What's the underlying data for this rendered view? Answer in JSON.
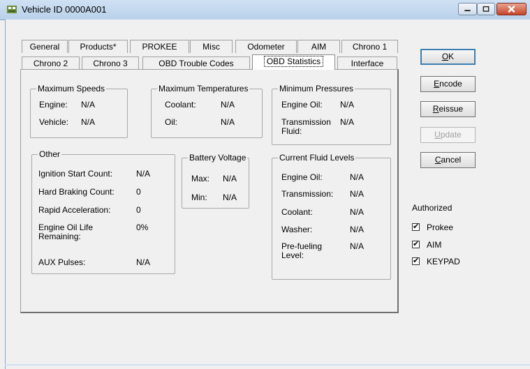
{
  "window": {
    "title": "Vehicle ID 0000A001"
  },
  "tabs": {
    "row1": [
      "General",
      "Products*",
      "PROKEE",
      "Misc",
      "Odometer",
      "AIM",
      "Chrono 1"
    ],
    "row2": [
      "Chrono 2",
      "Chrono 3",
      "OBD Trouble Codes",
      "OBD Statistics",
      "Interface"
    ],
    "selected": "OBD Statistics"
  },
  "groups": {
    "max_speeds": {
      "title": "Maximum Speeds",
      "engine_label": "Engine:",
      "engine_value": "N/A",
      "vehicle_label": "Vehicle:",
      "vehicle_value": "N/A"
    },
    "max_temps": {
      "title": "Maximum Temperatures",
      "coolant_label": "Coolant:",
      "coolant_value": "N/A",
      "oil_label": "Oil:",
      "oil_value": "N/A"
    },
    "min_pressures": {
      "title": "Minimum Pressures",
      "engine_oil_label": "Engine Oil:",
      "engine_oil_value": "N/A",
      "transmission_label_1": "Transmission",
      "transmission_label_2": "Fluid:",
      "transmission_value": "N/A"
    },
    "other": {
      "title": "Other",
      "ignition_label": "Ignition Start Count:",
      "ignition_value": "N/A",
      "braking_label": "Hard Braking Count:",
      "braking_value": "0",
      "accel_label": "Rapid Acceleration:",
      "accel_value": "0",
      "oil_life_label_1": "Engine Oil Life",
      "oil_life_label_2": "Remaining:",
      "oil_life_value": "0%",
      "aux_label": "AUX Pulses:",
      "aux_value": "N/A"
    },
    "battery": {
      "title": "Battery Voltage",
      "max_label": "Max:",
      "max_value": "N/A",
      "min_label": "Min:",
      "min_value": "N/A"
    },
    "fluid_levels": {
      "title": "Current Fluid Levels",
      "engine_oil_label": "Engine Oil:",
      "engine_oil_value": "N/A",
      "transmission_label": "Transmission:",
      "transmission_value": "N/A",
      "coolant_label": "Coolant:",
      "coolant_value": "N/A",
      "washer_label": "Washer:",
      "washer_value": "N/A",
      "prefueling_label_1": "Pre-fueling",
      "prefueling_label_2": "Level:",
      "prefueling_value": "N/A"
    }
  },
  "buttons": {
    "ok": {
      "mnemonic": "O",
      "rest": "K"
    },
    "encode": {
      "mnemonic": "E",
      "rest": "ncode"
    },
    "reissue": {
      "mnemonic": "R",
      "rest": "eissue"
    },
    "update": {
      "mnemonic": "U",
      "rest": "pdate",
      "enabled": false
    },
    "cancel": {
      "mnemonic": "C",
      "rest": "ancel"
    }
  },
  "authorized": {
    "title": "Authorized",
    "items": [
      {
        "label": "Prokee",
        "checked": true
      },
      {
        "label": "AIM",
        "checked": true
      },
      {
        "label": "KEYPAD",
        "checked": true
      }
    ]
  },
  "colors": {
    "titlebar": "#b9d1ea",
    "close_button": "#c7452a",
    "ok_border": "#3c7fb1",
    "disabled_text": "#a0a0a0"
  }
}
